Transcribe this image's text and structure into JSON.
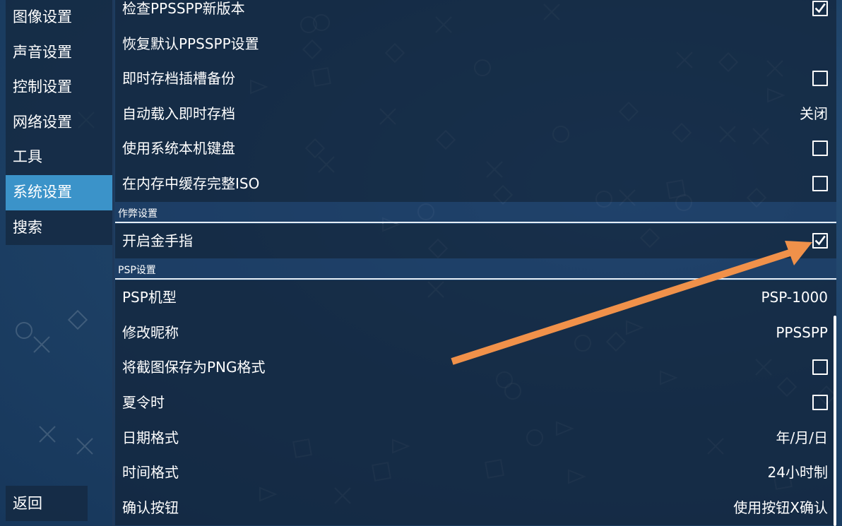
{
  "sidebar": {
    "items": [
      {
        "label": "图像设置",
        "active": false
      },
      {
        "label": "声音设置",
        "active": false
      },
      {
        "label": "控制设置",
        "active": false
      },
      {
        "label": "网络设置",
        "active": false
      },
      {
        "label": "工具",
        "active": false
      },
      {
        "label": "系统设置",
        "active": true
      },
      {
        "label": "搜索",
        "active": false
      }
    ],
    "back_label": "返回"
  },
  "settings": {
    "general": [
      {
        "label": "检查PPSSPP新版本",
        "checkbox": true,
        "checked": true
      },
      {
        "label": "恢复默认PPSSPP设置"
      },
      {
        "label": "即时存档插槽备份",
        "checkbox": true,
        "checked": false
      },
      {
        "label": "自动载入即时存档",
        "value": "关闭"
      },
      {
        "label": "使用系统本机键盘",
        "checkbox": true,
        "checked": false
      },
      {
        "label": "在内存中缓存完整ISO",
        "checkbox": true,
        "checked": false
      }
    ],
    "cheats_header": "作弊设置",
    "cheats": [
      {
        "label": "开启金手指",
        "checkbox": true,
        "checked": true
      }
    ],
    "psp_header": "PSP设置",
    "psp": [
      {
        "label": "PSP机型",
        "value": "PSP-1000"
      },
      {
        "label": "修改昵称",
        "value": "PPSSPP"
      },
      {
        "label": "将截图保存为PNG格式",
        "checkbox": true,
        "checked": false
      },
      {
        "label": "夏令时",
        "checkbox": true,
        "checked": false
      },
      {
        "label": "日期格式",
        "value": "年/月/日"
      },
      {
        "label": "时间格式",
        "value": "24小时制"
      },
      {
        "label": "确认按钮",
        "value": "使用按钮X确认"
      }
    ]
  },
  "colors": {
    "accent": "#3b93c9",
    "annotation_arrow": "#f0914a",
    "background": "#1f4368"
  },
  "icons": [
    "checkbox-checked-icon",
    "checkbox-empty-icon",
    "annotation-arrow"
  ]
}
